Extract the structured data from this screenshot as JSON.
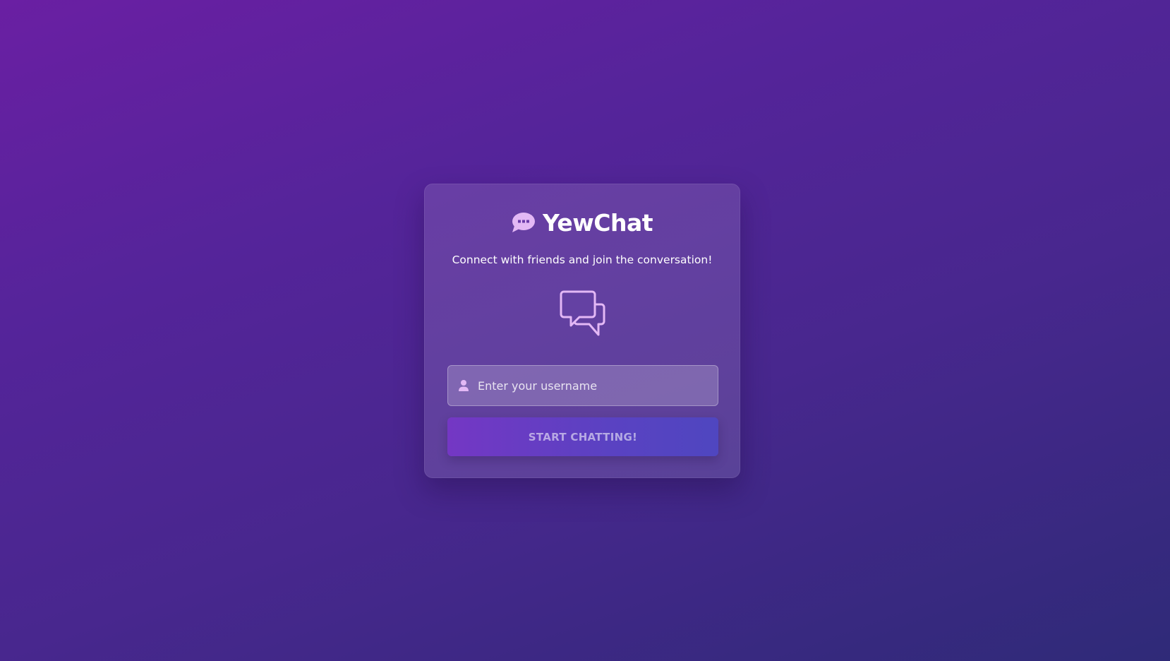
{
  "app": {
    "title": "YewChat",
    "tagline": "Connect with friends and join the conversation!",
    "brand_icon": "chat-bubble-dots-icon",
    "hero_icon": "chat-bubbles-icon"
  },
  "login": {
    "username_placeholder": "Enter your username",
    "username_value": "",
    "user_icon": "user-icon",
    "start_button_label": "START CHATTING!"
  },
  "colors": {
    "background_start": "#6a1fa3",
    "background_end": "#2f2a78",
    "icon_accent": "#e3b8f5",
    "button_start": "#7437c4",
    "button_end": "#4f46c0"
  }
}
